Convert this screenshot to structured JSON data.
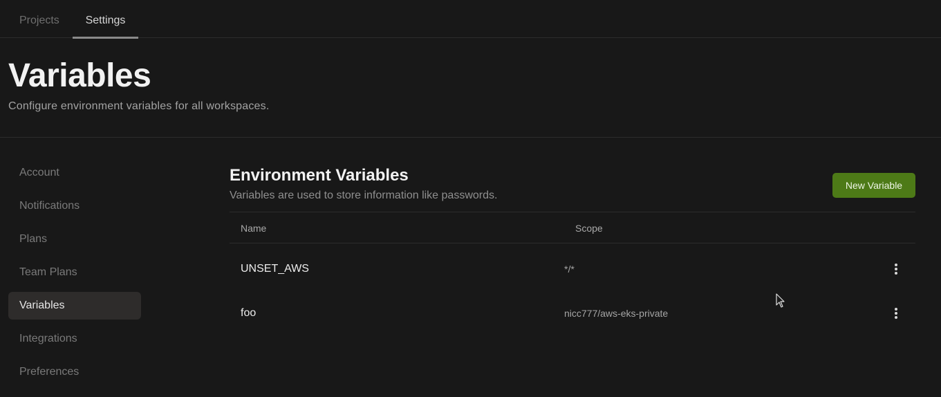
{
  "topnav": {
    "tabs": [
      {
        "label": "Projects"
      },
      {
        "label": "Settings"
      }
    ]
  },
  "header": {
    "title": "Variables",
    "subtitle": "Configure environment variables for all workspaces."
  },
  "sidebar": {
    "items": [
      {
        "label": "Account"
      },
      {
        "label": "Notifications"
      },
      {
        "label": "Plans"
      },
      {
        "label": "Team Plans"
      },
      {
        "label": "Variables"
      },
      {
        "label": "Integrations"
      },
      {
        "label": "Preferences"
      }
    ],
    "active": "Variables"
  },
  "section": {
    "title": "Environment Variables",
    "description": "Variables are used to store information like passwords.",
    "new_button_label": "New Variable"
  },
  "table": {
    "columns": {
      "name": "Name",
      "scope": "Scope"
    },
    "rows": [
      {
        "name": "UNSET_AWS",
        "scope": "*/*"
      },
      {
        "name": "foo",
        "scope": "nicc777/aws-eks-private"
      }
    ]
  },
  "colors": {
    "background": "#181818",
    "primary_button": "#4d7a17",
    "active_item": "#2e2c2b"
  }
}
